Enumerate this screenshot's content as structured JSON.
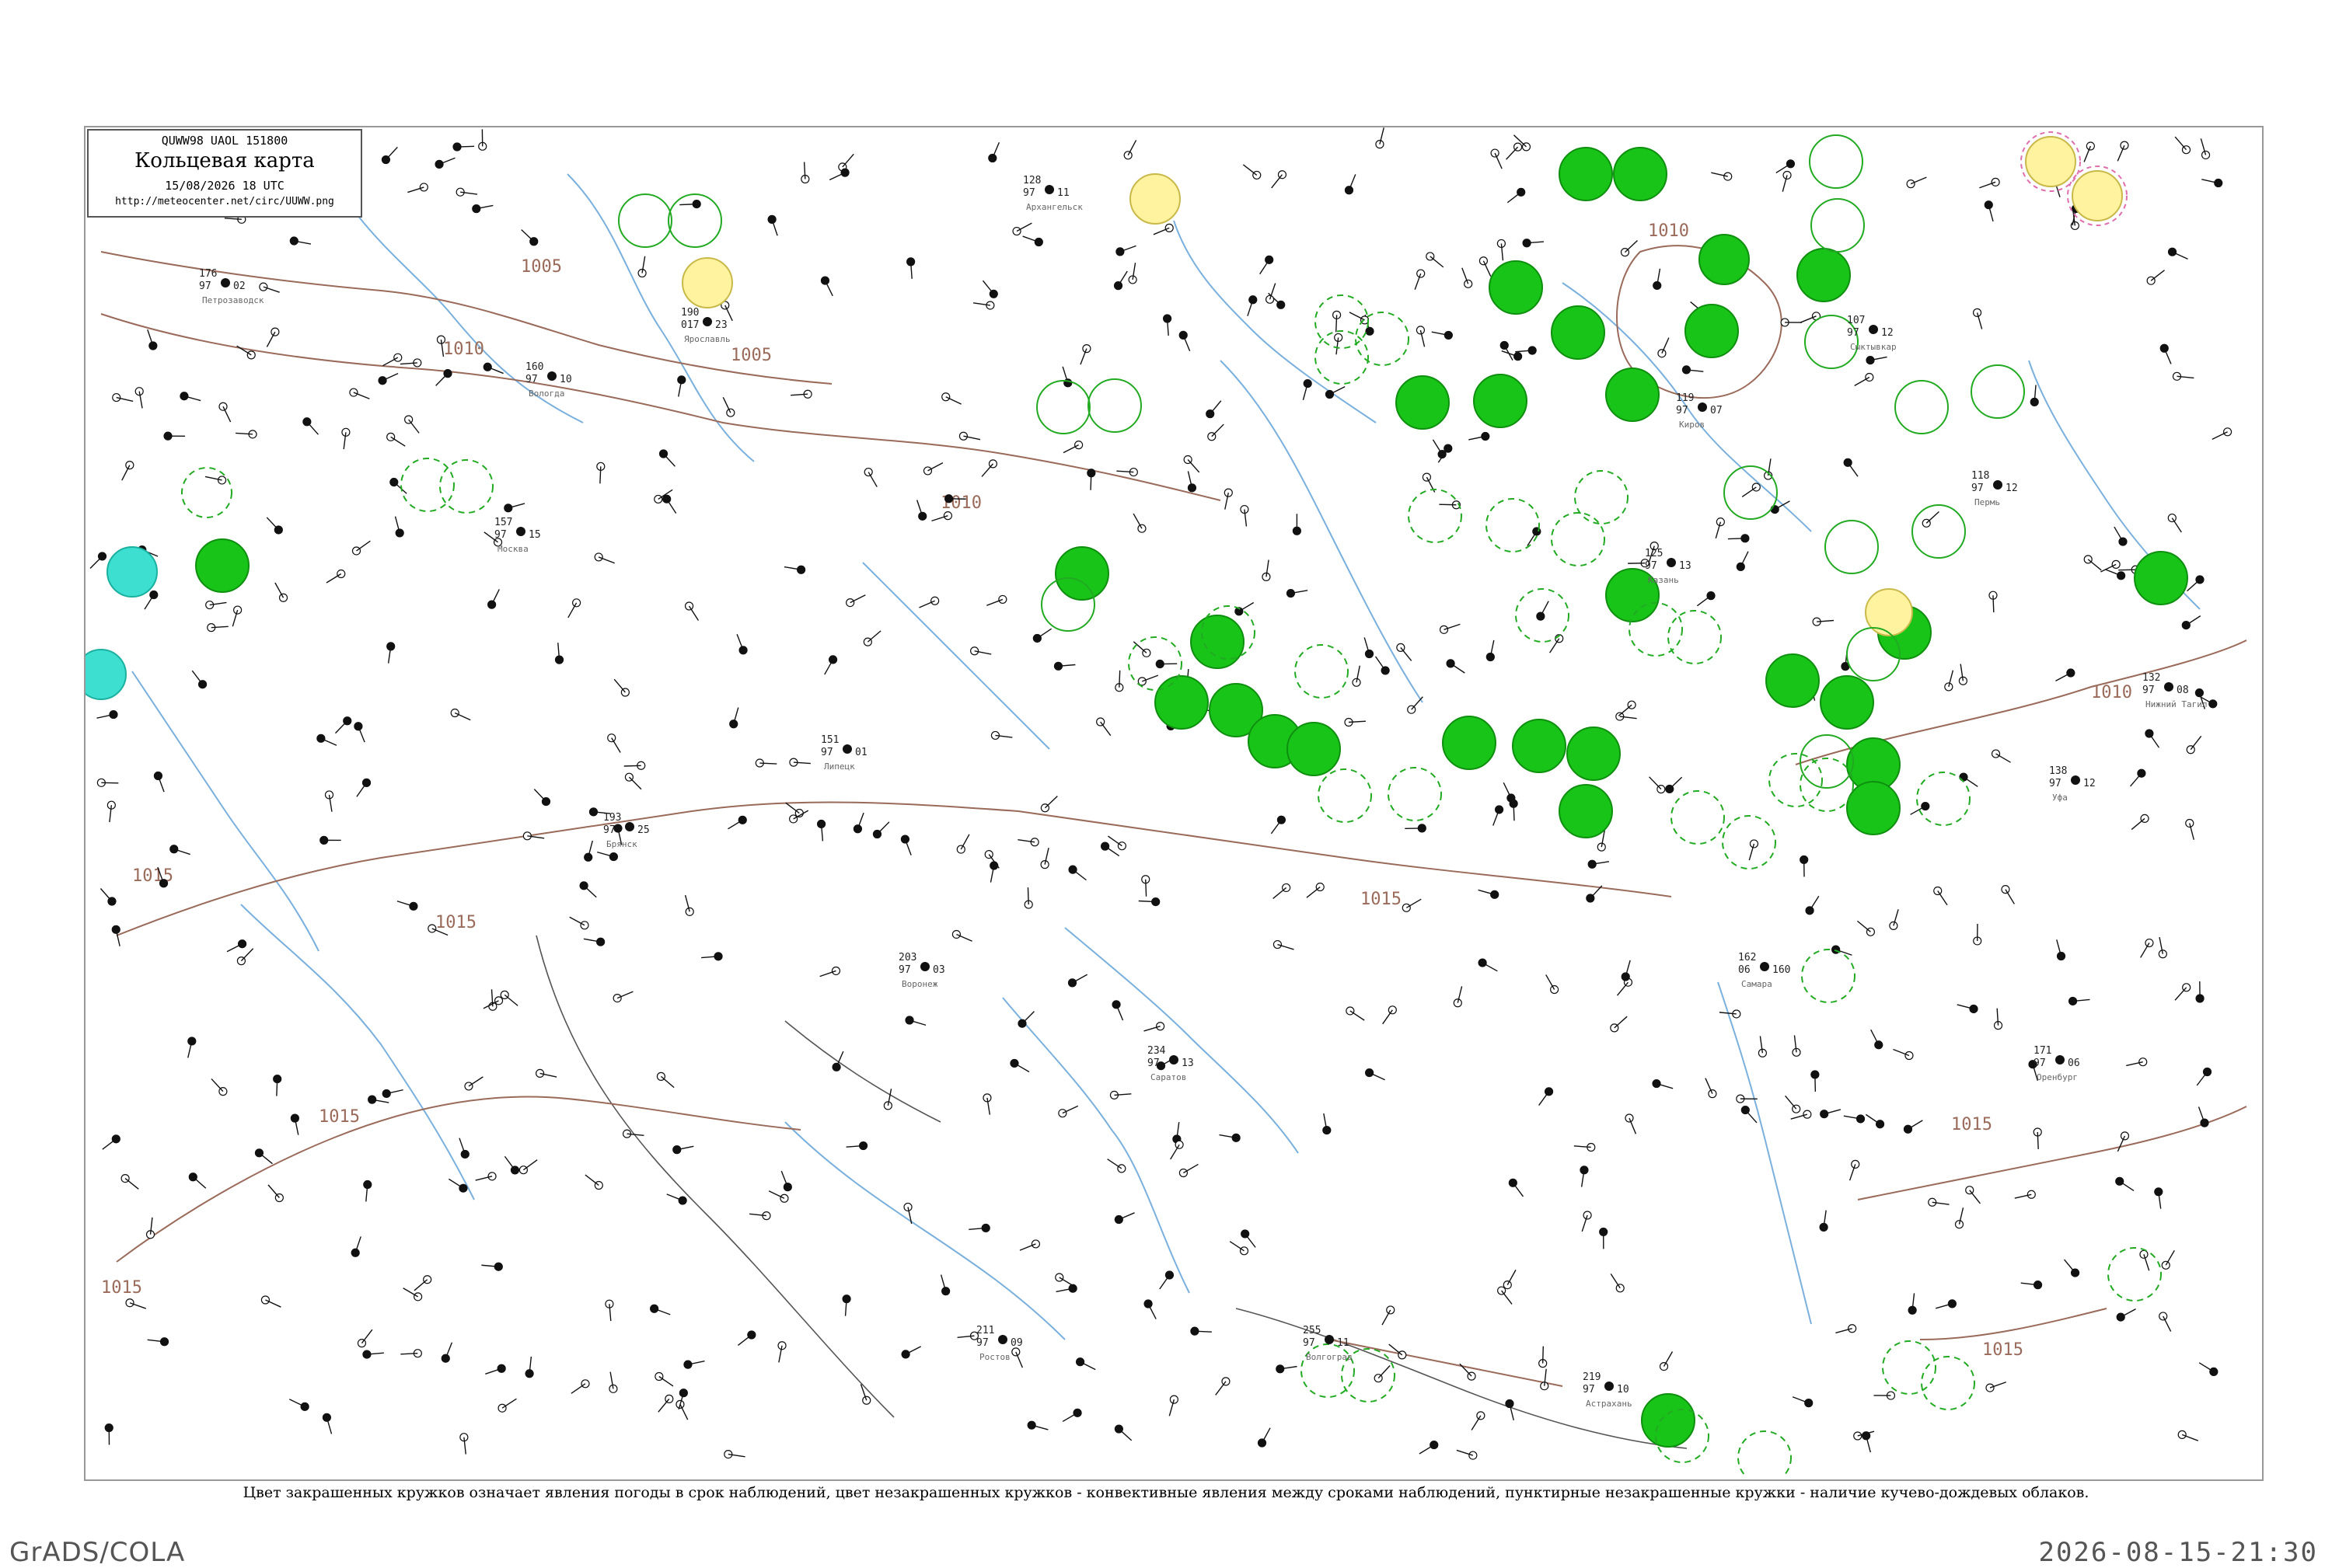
{
  "header": {
    "code_line": "QUWW98  UAOL  151800",
    "title": "Кольцевая карта",
    "date": "15/08/2026 18 UTC",
    "url": "http://meteocenter.net/circ/UUWW.png"
  },
  "caption": "Цвет закрашенных кружков означает явления погоды в срок наблюдений, цвет незакрашенных кружков - конвективные явления между сроками наблюдений, пунктирные незакрашенные кружки - наличие кучево-дождевых облаков.",
  "footer": {
    "brand": "GrADS/COLA",
    "timestamp": "2026-08-15-21:30"
  },
  "isobars": [
    {
      "label": "1005"
    },
    {
      "label": "1005"
    },
    {
      "label": "1010"
    },
    {
      "label": "1010"
    },
    {
      "label": "1010"
    },
    {
      "label": "1015"
    },
    {
      "label": "1015"
    },
    {
      "label": "1015"
    },
    {
      "label": "1015"
    },
    {
      "label": "1015"
    },
    {
      "label": "1010"
    },
    {
      "label": "1015"
    },
    {
      "label": "1015"
    }
  ],
  "colors": {
    "rain": "#18c418",
    "thunder_ring": "#22aa22",
    "yellow": "#fff3a0",
    "cyan": "#3de0d0",
    "isobar": "#9a6a5a",
    "river": "#7ab0dd",
    "border": "#555555"
  },
  "stations": [
    {
      "name": "Москва",
      "t": "157",
      "p": "97",
      "n": "15"
    },
    {
      "name": "Ярославль",
      "t": "190",
      "p": "017",
      "n": "23"
    },
    {
      "name": "Казань",
      "t": "125",
      "p": "97",
      "n": "13"
    },
    {
      "name": "Самара",
      "t": "162",
      "p": "06",
      "n": "160"
    },
    {
      "name": "Саратов",
      "t": "234",
      "p": "97",
      "n": "13"
    },
    {
      "name": "Воронеж",
      "t": "203",
      "p": "97",
      "n": "03"
    },
    {
      "name": "Пермь",
      "t": "118",
      "p": "97",
      "n": "12"
    },
    {
      "name": "Уфа",
      "t": "138",
      "p": "97",
      "n": "12"
    },
    {
      "name": "Оренбург",
      "t": "171",
      "p": "97",
      "n": "06"
    },
    {
      "name": "Астрахань",
      "t": "219",
      "p": "97",
      "n": "10"
    },
    {
      "name": "Волгоград",
      "t": "255",
      "p": "97",
      "n": "11"
    },
    {
      "name": "Ростов",
      "t": "211",
      "p": "97",
      "n": "09"
    },
    {
      "name": "Нижний Тагил",
      "t": "132",
      "p": "97",
      "n": "08"
    },
    {
      "name": "Сыктывкар",
      "t": "107",
      "p": "97",
      "n": "12"
    },
    {
      "name": "Киров",
      "t": "119",
      "p": "97",
      "n": "07"
    },
    {
      "name": "Петрозаводск",
      "t": "176",
      "p": "97",
      "n": "02"
    },
    {
      "name": "Архангельск",
      "t": "128",
      "p": "97",
      "n": "11"
    },
    {
      "name": "Вологда",
      "t": "160",
      "p": "97",
      "n": "10"
    },
    {
      "name": "Брянск",
      "t": "193",
      "p": "97",
      "n": "25"
    },
    {
      "name": "Липецк",
      "t": "151",
      "p": "97",
      "n": "01"
    }
  ]
}
